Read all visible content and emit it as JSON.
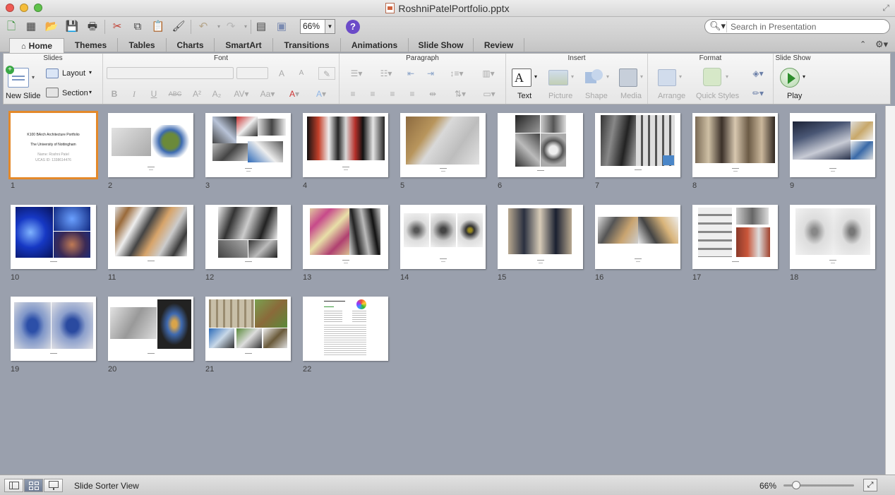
{
  "window": {
    "title": "RoshniPatelPortfolio.pptx"
  },
  "toolbar": {
    "zoom_value": "66%",
    "search_placeholder": "Search in Presentation"
  },
  "tabs": [
    "Home",
    "Themes",
    "Tables",
    "Charts",
    "SmartArt",
    "Transitions",
    "Animations",
    "Slide Show",
    "Review"
  ],
  "active_tab": "Home",
  "ribbon": {
    "groups": {
      "slides": "Slides",
      "font": "Font",
      "paragraph": "Paragraph",
      "insert": "Insert",
      "format": "Format",
      "slideshow": "Slide Show"
    },
    "new_slide": "New Slide",
    "layout": "Layout",
    "section": "Section",
    "text": "Text",
    "picture": "Picture",
    "shape": "Shape",
    "media": "Media",
    "arrange": "Arrange",
    "quick_styles": "Quick Styles",
    "play": "Play",
    "font_buttons": {
      "bold": "B",
      "italic": "I",
      "underline": "U",
      "strike": "ABC",
      "superscript": "A²",
      "subscript": "A₂",
      "grow": "A",
      "shrink": "A"
    }
  },
  "slide1": {
    "title": "K100 BArch Architecture Portfolio",
    "subtitle": "The University of Nottingham",
    "name": "Name: Roshni Patel",
    "ucas": "UCAS ID: 1338614476"
  },
  "slides": [
    "1",
    "2",
    "3",
    "4",
    "5",
    "6",
    "7",
    "8",
    "9",
    "10",
    "11",
    "12",
    "13",
    "14",
    "15",
    "16",
    "17",
    "18",
    "19",
    "20",
    "21",
    "22"
  ],
  "status": {
    "view_name": "Slide Sorter View",
    "zoom": "66%"
  },
  "zoom_level_percent": 66,
  "colors": {
    "selection": "#e4892a",
    "background": "#9aa0ad"
  }
}
